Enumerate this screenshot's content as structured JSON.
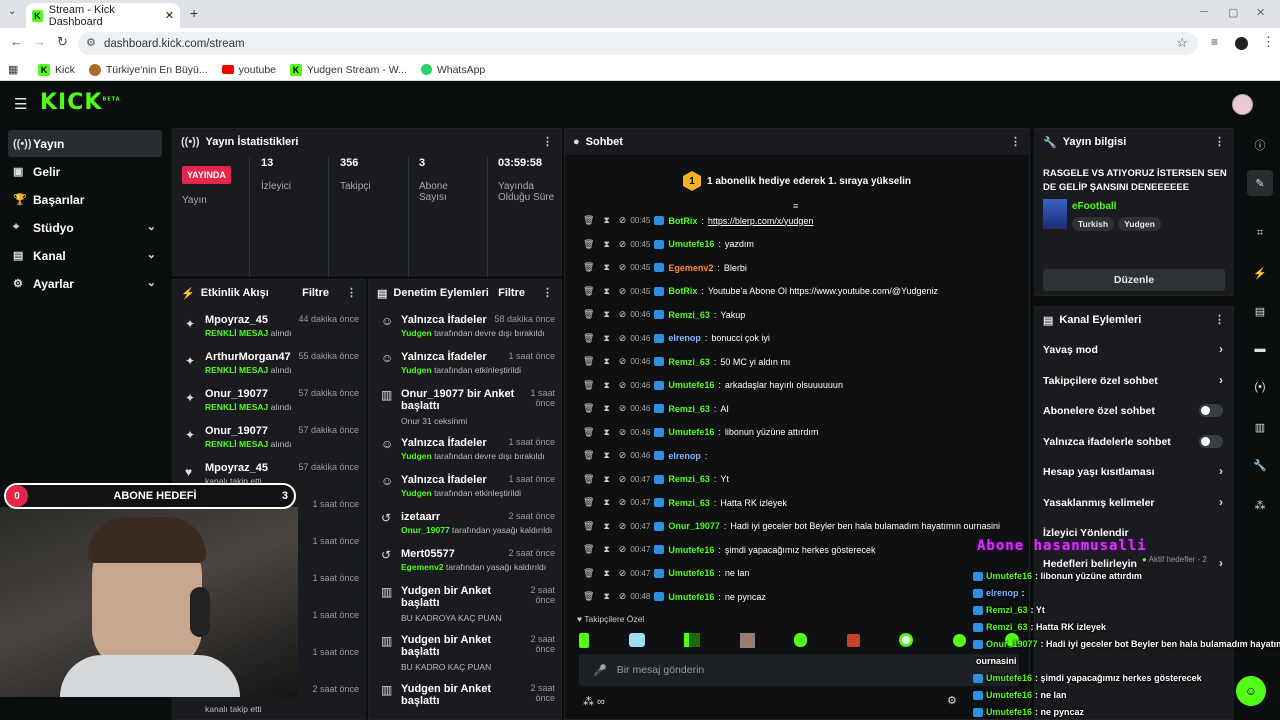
{
  "browser": {
    "tab_title": "Stream - Kick Dashboard",
    "url": "dashboard.kick.com/stream",
    "bookmarks": [
      "Kick",
      "Türkiye'nin En Büyü...",
      "youtube",
      "Yudgen Stream - W...",
      "WhatsApp"
    ]
  },
  "app": {
    "logo": "KICK",
    "logo_beta": "BETA"
  },
  "nav": {
    "items": [
      "Yayın",
      "Gelir",
      "Başarılar",
      "Stüdyo",
      "Kanal",
      "Ayarlar"
    ]
  },
  "stats": {
    "title": "Yayın İstatistikleri",
    "live_badge": "YAYINDA",
    "live_label": "Yayın",
    "viewers_value": "13",
    "viewers_label": "İzleyici",
    "followers_value": "356",
    "followers_label": "Takipçi",
    "subs_value": "3",
    "subs_label": "Abone Sayısı",
    "uptime_value": "03:59:58",
    "uptime_label": "Yayında Olduğu Süre"
  },
  "activity": {
    "title": "Etkinlik Akışı",
    "filter": "Filtre",
    "items": [
      {
        "name": "Mpoyraz_45",
        "highlight": "RENKLİ MESAJ",
        "rest": " alındı",
        "time": "44 dakika önce"
      },
      {
        "name": "ArthurMorgan47",
        "highlight": "RENKLİ MESAJ",
        "rest": " alındı",
        "time": "55 dakika önce"
      },
      {
        "name": "Onur_19077",
        "highlight": "RENKLİ MESAJ",
        "rest": " alındı",
        "time": "57 dakika önce"
      },
      {
        "name": "Onur_19077",
        "highlight": "RENKLİ MESAJ",
        "rest": " alındı",
        "time": "57 dakika önce"
      },
      {
        "name": "Mpoyraz_45",
        "highlight": "",
        "rest": "kanalı takip etti",
        "time": "57 dakika önce"
      },
      {
        "name": "ArthurMorgan47",
        "highlight": "RENKLİ MESAJ",
        "rest": " alındı",
        "time": "1 saat önce"
      }
    ],
    "extra_times": [
      "1 saat önce",
      "1 saat önce",
      "1 saat önce",
      "1 saat önce",
      "2 saat önce"
    ],
    "last_sub": "kanalı takip etti"
  },
  "goal": {
    "label": "ABONE HEDEFİ",
    "current": "0",
    "target": "3"
  },
  "moderation": {
    "title": "Denetim Eylemleri",
    "filter": "Filtre",
    "items": [
      {
        "title": "Yalnızca İfadeler",
        "user": "Yudgen",
        "rest": " tarafından devre dışı bırakıldı",
        "time": "58 dakika önce"
      },
      {
        "title": "Yalnızca İfadeler",
        "user": "Yudgen",
        "rest": " tarafından etkinleştirildi",
        "time": "1 saat önce"
      },
      {
        "title": "Onur_19077 bir Anket başlattı",
        "user": "",
        "rest": "Onur 31 ceksinmi",
        "time": "1 saat önce"
      },
      {
        "title": "Yalnızca İfadeler",
        "user": "Yudgen",
        "rest": " tarafından devre dışı bırakıldı",
        "time": "1 saat önce"
      },
      {
        "title": "Yalnızca İfadeler",
        "user": "Yudgen",
        "rest": " tarafından etkinleştirildi",
        "time": "1 saat önce"
      },
      {
        "title": "izetaarr",
        "user": "Onur_19077",
        "rest": " tarafından yasağı kaldırıldı",
        "time": "2 saat önce"
      },
      {
        "title": "Mert05577",
        "user": "Egemenv2",
        "rest": " tarafından yasağı kaldırıldı",
        "time": "2 saat önce"
      },
      {
        "title": "Yudgen bir Anket başlattı",
        "user": "",
        "rest": "BU KADROYA KAÇ PUAN",
        "time": "2 saat önce"
      },
      {
        "title": "Yudgen bir Anket başlattı",
        "user": "",
        "rest": "BU KADRO KAÇ PUAN",
        "time": "2 saat önce"
      },
      {
        "title": "Yudgen bir Anket başlattı",
        "user": "",
        "rest": "",
        "time": "2 saat önce"
      }
    ]
  },
  "chat": {
    "title": "Sohbet",
    "banner_rank": "1",
    "banner": "1 abonelik hediye ederek 1. sıraya yükselin",
    "messages": [
      {
        "time": "00:45",
        "user": "BotRix",
        "color": "#53fc18",
        "text": "https://blerp.com/x/yudgen",
        "link": true
      },
      {
        "time": "00:45",
        "user": "Umutefe16",
        "color": "#53fc18",
        "text": "yazdım",
        "link": false
      },
      {
        "time": "00:45",
        "user": "Egemenv2",
        "color": "#ff8a2b",
        "text": "Blerbi",
        "link": false
      },
      {
        "time": "00:45",
        "user": "BotRix",
        "color": "#53fc18",
        "text": "Youtube'a Abone Ol https://www.youtube.com/@Yudgeniz",
        "link": false
      },
      {
        "time": "00:46",
        "user": "Remzi_63",
        "color": "#53fc18",
        "text": "Yakup",
        "link": false
      },
      {
        "time": "00:46",
        "user": "elrenop",
        "color": "#7fb5ff",
        "text": "bonucci çok iyi",
        "link": false
      },
      {
        "time": "00:46",
        "user": "Remzi_63",
        "color": "#53fc18",
        "text": "50 MC yi aldın mı",
        "link": false
      },
      {
        "time": "00:46",
        "user": "Umutefe16",
        "color": "#53fc18",
        "text": "arkadaşlar hayırlı olsuuuuuun",
        "link": false
      },
      {
        "time": "00:46",
        "user": "Remzi_63",
        "color": "#53fc18",
        "text": "AI",
        "link": false
      },
      {
        "time": "00:46",
        "user": "Umutefe16",
        "color": "#53fc18",
        "text": "libonun yüzüne attırdım",
        "link": false
      },
      {
        "time": "00:46",
        "user": "elrenop",
        "color": "#7fb5ff",
        "text": "",
        "link": false
      },
      {
        "time": "00:47",
        "user": "Remzi_63",
        "color": "#53fc18",
        "text": "Yt",
        "link": false
      },
      {
        "time": "00:47",
        "user": "Remzi_63",
        "color": "#53fc18",
        "text": "Hatta RK izleyek",
        "link": false
      },
      {
        "time": "00:47",
        "user": "Onur_19077",
        "color": "#53fc18",
        "text": "Hadi iyi geceler bot Beyler ben hala bulamadım hayatımın ournasini",
        "link": false
      },
      {
        "time": "00:47",
        "user": "Umutefe16",
        "color": "#53fc18",
        "text": "şimdi yapacağımız herkes gösterecek",
        "link": false
      },
      {
        "time": "00:47",
        "user": "Umutefe16",
        "color": "#53fc18",
        "text": "ne lan",
        "link": false
      },
      {
        "time": "00:48",
        "user": "Umutefe16",
        "color": "#53fc18",
        "text": "ne pyncaz",
        "link": false
      }
    ],
    "followers_label": "Takipçilere Özel",
    "input_placeholder": "Bir mesaj gönderin"
  },
  "stream_info": {
    "title": "Yayın bilgisi",
    "stream_title": "RASGELE VS ATIYORUZ İSTERSEN SEN DE GELİP ŞANSINI DENEEEEEE",
    "category": "eFootball",
    "tags": [
      "Turkish",
      "Yudgen"
    ],
    "edit_button": "Düzenle"
  },
  "channel_actions": {
    "title": "Kanal Eylemleri",
    "items": [
      {
        "label": "Yavaş mod",
        "kind": "arrow"
      },
      {
        "label": "Takipçilere özel sohbet",
        "kind": "arrow"
      },
      {
        "label": "Abonelere özel sohbet",
        "kind": "toggle"
      },
      {
        "label": "Yalnızca ifadelerle sohbet",
        "kind": "toggle"
      },
      {
        "label": "Hesap yaşı kısıtlaması",
        "kind": "arrow"
      },
      {
        "label": "Yasaklanmış kelimeler",
        "kind": "arrow"
      },
      {
        "label": "İzleyici Yönlendir",
        "kind": "none"
      },
      {
        "label": "Hedefleri belirleyin",
        "kind": "arrow"
      }
    ],
    "goals_status": "Aktif hedefler - 2"
  },
  "overlay": {
    "headline": "Abone hasanmusalli",
    "lines": [
      {
        "user": "Umutefe16",
        "text": ": libonun yüzüne attırdım",
        "color": "#53fc18"
      },
      {
        "user": "elrenop",
        "text": ":",
        "color": "#7fb5ff"
      },
      {
        "user": "Remzi_63",
        "text": ": Yt",
        "color": "#53fc18"
      },
      {
        "user": "Remzi_63",
        "text": ": Hatta RK izleyek",
        "color": "#53fc18"
      },
      {
        "user": "Onur_19077",
        "text": ": Hadi iyi geceler bot Beyler ben hala bulamadım hayatımın",
        "color": "#53fc18"
      },
      {
        "user": "",
        "text": "ournasini",
        "color": "#fff"
      },
      {
        "user": "Umutefe16",
        "text": ": şimdi yapacağımız herkes gösterecek",
        "color": "#53fc18"
      },
      {
        "user": "Umutefe16",
        "text": ": ne lan",
        "color": "#53fc18"
      },
      {
        "user": "Umutefe16",
        "text": ": ne pyncaz",
        "color": "#53fc18"
      }
    ]
  },
  "colors": {
    "accent": "#53fc18",
    "live": "#e3264a",
    "panel": "#191b1f"
  }
}
